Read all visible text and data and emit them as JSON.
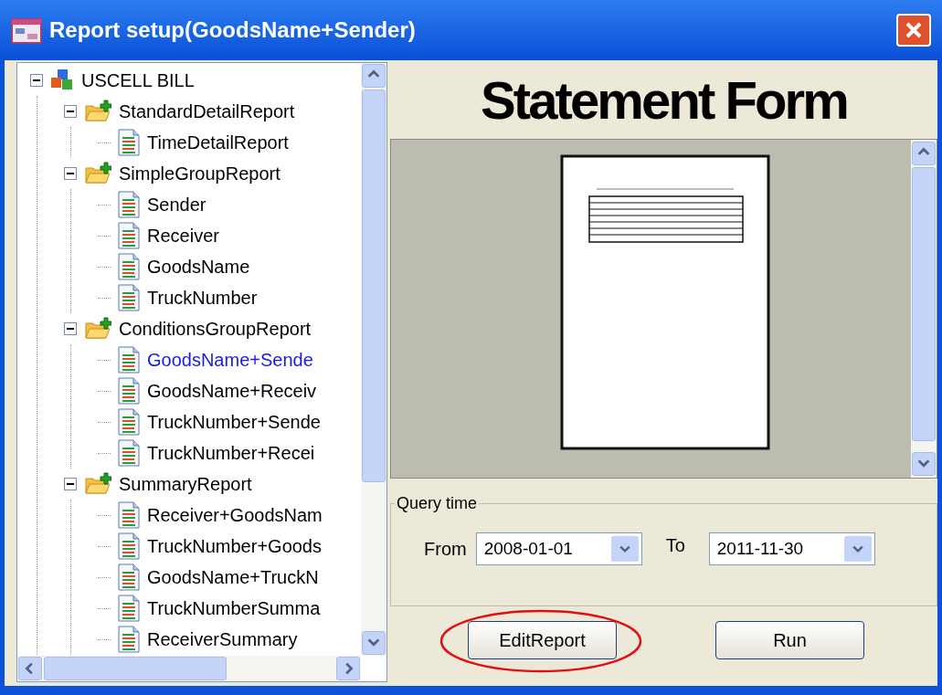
{
  "window": {
    "title": "Report setup(GoodsName+Sender)"
  },
  "tree": [
    {
      "label": "USCELL BILL",
      "kind": "root",
      "expanded": true,
      "selected": false,
      "children": [
        {
          "label": "StandardDetailReport",
          "kind": "folder",
          "expanded": true,
          "selected": false,
          "children": [
            {
              "label": "TimeDetailReport",
              "kind": "report",
              "selected": false
            }
          ]
        },
        {
          "label": "SimpleGroupReport",
          "kind": "folder",
          "expanded": true,
          "selected": false,
          "children": [
            {
              "label": "Sender",
              "kind": "report",
              "selected": false
            },
            {
              "label": "Receiver",
              "kind": "report",
              "selected": false
            },
            {
              "label": "GoodsName",
              "kind": "report",
              "selected": false
            },
            {
              "label": "TruckNumber",
              "kind": "report",
              "selected": false
            }
          ]
        },
        {
          "label": "ConditionsGroupReport",
          "kind": "folder",
          "expanded": true,
          "selected": false,
          "children": [
            {
              "label": "GoodsName+Sende",
              "kind": "report",
              "selected": true
            },
            {
              "label": "GoodsName+Receiv",
              "kind": "report",
              "selected": false
            },
            {
              "label": "TruckNumber+Sende",
              "kind": "report",
              "selected": false
            },
            {
              "label": "TruckNumber+Recei",
              "kind": "report",
              "selected": false
            }
          ]
        },
        {
          "label": "SummaryReport",
          "kind": "folder",
          "expanded": true,
          "selected": false,
          "children": [
            {
              "label": "Receiver+GoodsNam",
              "kind": "report",
              "selected": false
            },
            {
              "label": "TruckNumber+Goods",
              "kind": "report",
              "selected": false
            },
            {
              "label": "GoodsName+TruckN",
              "kind": "report",
              "selected": false
            },
            {
              "label": "TruckNumberSumma",
              "kind": "report",
              "selected": false
            },
            {
              "label": "ReceiverSummary",
              "kind": "report",
              "selected": false
            }
          ]
        }
      ]
    }
  ],
  "banner": {
    "title": "Statement Form"
  },
  "query": {
    "legend": "Query time",
    "from_label": "From",
    "from_value": "2008-01-01",
    "to_label": "To",
    "to_value": "2011-11-30"
  },
  "buttons": [
    {
      "label": "EditReport",
      "highlighted": true
    },
    {
      "label": "Run",
      "highlighted": false
    }
  ]
}
